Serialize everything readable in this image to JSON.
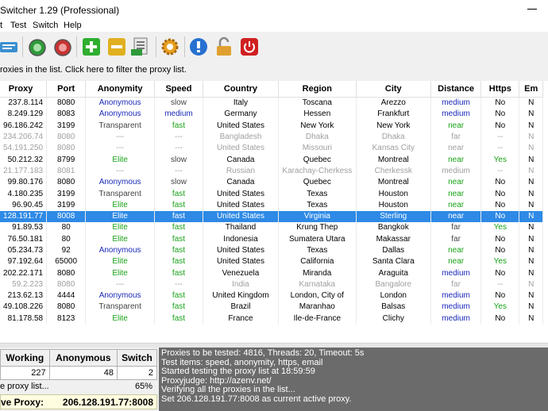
{
  "window": {
    "title": "Switcher 1.29 (Professional)"
  },
  "menu": {
    "items": [
      "t",
      "Test",
      "Switch",
      "Help"
    ]
  },
  "toolbar": {
    "buttons": [
      {
        "name": "import-list-icon",
        "color": "#3a8fd0"
      },
      {
        "name": "start-test-icon",
        "color": "#2e9a3a"
      },
      {
        "name": "stop-test-icon",
        "color": "#c83232"
      },
      {
        "name": "add-proxy-icon",
        "color": "#2fae2f"
      },
      {
        "name": "remove-proxy-icon",
        "color": "#e0b020"
      },
      {
        "name": "export-list-icon",
        "color": "#7a7a7a"
      },
      {
        "name": "settings-gear-icon",
        "color": "#e8a020"
      },
      {
        "name": "info-icon",
        "color": "#2870d0"
      },
      {
        "name": "unlock-icon",
        "color": "#e0a030"
      },
      {
        "name": "power-icon",
        "color": "#d02020"
      }
    ]
  },
  "filter_bar": {
    "text": "roxies in the list. Click here to filter the proxy list."
  },
  "grid": {
    "columns": [
      "Proxy",
      "Port",
      "Anonymity",
      "Speed",
      "Country",
      "Region",
      "City",
      "Distance",
      "Https",
      "Em"
    ],
    "rows": [
      {
        "proxy": "237.8.114",
        "port": "8080",
        "anonymity": "Anonymous",
        "speed": "slow",
        "country": "Italy",
        "region": "Toscana",
        "city": "Arezzo",
        "distance": "medium",
        "https": "No",
        "email": "N",
        "state": "normal"
      },
      {
        "proxy": "8.249.129",
        "port": "8083",
        "anonymity": "Anonymous",
        "speed": "medium",
        "country": "Germany",
        "region": "Hessen",
        "city": "Frankfurt",
        "distance": "medium",
        "https": "No",
        "email": "N",
        "state": "normal"
      },
      {
        "proxy": "96.186.242",
        "port": "3199",
        "anonymity": "Transparent",
        "speed": "fast",
        "country": "United States",
        "region": "New York",
        "city": "New York",
        "distance": "near",
        "https": "No",
        "email": "N",
        "state": "normal"
      },
      {
        "proxy": "234.206.74",
        "port": "8080",
        "anonymity": "---",
        "speed": "---",
        "country": "Bangladesh",
        "region": "Dhaka",
        "city": "Dhaka",
        "distance": "far",
        "https": "--",
        "email": "N",
        "state": "dim"
      },
      {
        "proxy": "54.191.250",
        "port": "8080",
        "anonymity": "---",
        "speed": "---",
        "country": "United States",
        "region": "Missouri",
        "city": "Kansas City",
        "distance": "near",
        "https": "--",
        "email": "N",
        "state": "dim"
      },
      {
        "proxy": "50.212.32",
        "port": "8799",
        "anonymity": "Elite",
        "speed": "slow",
        "country": "Canada",
        "region": "Quebec",
        "city": "Montreal",
        "distance": "near",
        "https": "Yes",
        "email": "N",
        "state": "normal"
      },
      {
        "proxy": "21.177.183",
        "port": "8081",
        "anonymity": "---",
        "speed": "---",
        "country": "Russian",
        "region": "Karachay-Cherkess",
        "city": "Cherkessk",
        "distance": "medium",
        "https": "--",
        "email": "N",
        "state": "dim"
      },
      {
        "proxy": "99.80.176",
        "port": "8080",
        "anonymity": "Anonymous",
        "speed": "slow",
        "country": "Canada",
        "region": "Quebec",
        "city": "Montreal",
        "distance": "near",
        "https": "No",
        "email": "N",
        "state": "normal"
      },
      {
        "proxy": "4.180.235",
        "port": "3199",
        "anonymity": "Transparent",
        "speed": "fast",
        "country": "United States",
        "region": "Texas",
        "city": "Houston",
        "distance": "near",
        "https": "No",
        "email": "N",
        "state": "normal"
      },
      {
        "proxy": "96.90.45",
        "port": "3199",
        "anonymity": "Elite",
        "speed": "fast",
        "country": "United States",
        "region": "Texas",
        "city": "Houston",
        "distance": "near",
        "https": "No",
        "email": "N",
        "state": "normal"
      },
      {
        "proxy": "128.191.77",
        "port": "8008",
        "anonymity": "Elite",
        "speed": "fast",
        "country": "United States",
        "region": "Virginia",
        "city": "Sterling",
        "distance": "near",
        "https": "No",
        "email": "N",
        "state": "selected"
      },
      {
        "proxy": "91.89.53",
        "port": "80",
        "anonymity": "Elite",
        "speed": "fast",
        "country": "Thailand",
        "region": "Krung Thep",
        "city": "Bangkok",
        "distance": "far",
        "https": "Yes",
        "email": "N",
        "state": "normal"
      },
      {
        "proxy": "76.50.181",
        "port": "80",
        "anonymity": "Elite",
        "speed": "fast",
        "country": "Indonesia",
        "region": "Sumatera Utara",
        "city": "Makassar",
        "distance": "far",
        "https": "No",
        "email": "N",
        "state": "normal"
      },
      {
        "proxy": "05.234.73",
        "port": "92",
        "anonymity": "Anonymous",
        "speed": "fast",
        "country": "United States",
        "region": "Texas",
        "city": "Dallas",
        "distance": "near",
        "https": "No",
        "email": "N",
        "state": "normal"
      },
      {
        "proxy": "97.192.64",
        "port": "65000",
        "anonymity": "Elite",
        "speed": "fast",
        "country": "United States",
        "region": "California",
        "city": "Santa Clara",
        "distance": "near",
        "https": "Yes",
        "email": "N",
        "state": "normal"
      },
      {
        "proxy": "202.22.171",
        "port": "8080",
        "anonymity": "Elite",
        "speed": "fast",
        "country": "Venezuela",
        "region": "Miranda",
        "city": "Araguita",
        "distance": "medium",
        "https": "No",
        "email": "N",
        "state": "normal"
      },
      {
        "proxy": "59.2.223",
        "port": "8080",
        "anonymity": "---",
        "speed": "---",
        "country": "India",
        "region": "Karnataka",
        "city": "Bangalore",
        "distance": "far",
        "https": "--",
        "email": "N",
        "state": "dim"
      },
      {
        "proxy": "213.62.13",
        "port": "4444",
        "anonymity": "Anonymous",
        "speed": "fast",
        "country": "United Kingdom",
        "region": "London, City of",
        "city": "London",
        "distance": "medium",
        "https": "No",
        "email": "N",
        "state": "normal"
      },
      {
        "proxy": "49.108.226",
        "port": "8080",
        "anonymity": "Transparent",
        "speed": "fast",
        "country": "Brazil",
        "region": "Maranhao",
        "city": "Balsas",
        "distance": "medium",
        "https": "Yes",
        "email": "N",
        "state": "normal"
      },
      {
        "proxy": "81.178.58",
        "port": "8123",
        "anonymity": "Elite",
        "speed": "fast",
        "country": "France",
        "region": "Ile-de-France",
        "city": "Clichy",
        "distance": "medium",
        "https": "No",
        "email": "N",
        "state": "normal"
      }
    ]
  },
  "stats": {
    "headers": [
      "Working",
      "Anonymous",
      "Switch"
    ],
    "values": [
      "227",
      "48",
      "2"
    ],
    "progress_label": "e proxy list...",
    "progress_value": "65%",
    "active_label": "ve Proxy:",
    "active_value": "206.128.191.77:8008"
  },
  "log": {
    "lines": [
      "Proxies to be tested: 4816, Threads: 20, Timeout: 5s",
      "Test items: speed, anonymity, https, email",
      "Started testing the proxy list at 18:59:59",
      "Proxyjudge: http://azenv.net/",
      "Verifying all the proxies in the list...",
      "Set 206.128.191.77:8008 as current active proxy."
    ]
  },
  "colors": {
    "selection": "#2e8ae6",
    "anonymous": "#1a28b8",
    "elite": "#17a217",
    "log_bg": "#6b6b6b"
  }
}
